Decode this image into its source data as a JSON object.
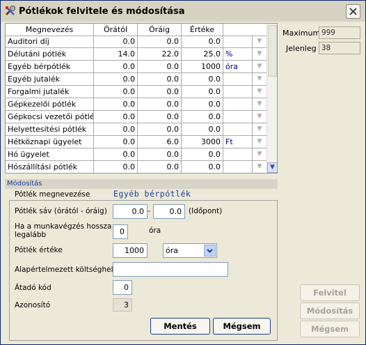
{
  "window": {
    "title": "Pótlékok felvitele és módosítása"
  },
  "grid": {
    "columns": [
      "Megnevezés",
      "Órától",
      "Óráig",
      "Értéke",
      ""
    ],
    "rows": [
      {
        "name": "Auditori díj",
        "from": "0.0",
        "to": "0.0",
        "value": "0.0",
        "unit": ""
      },
      {
        "name": "Délutáni pótlék",
        "from": "14.0",
        "to": "22.0",
        "value": "25.0",
        "unit": "%"
      },
      {
        "name": "Egyéb bérpótlék",
        "from": "0.0",
        "to": "0.0",
        "value": "1000",
        "unit": "óra"
      },
      {
        "name": "Egyéb jutalék",
        "from": "0.0",
        "to": "0.0",
        "value": "0.0",
        "unit": ""
      },
      {
        "name": "Forgalmi jutalék",
        "from": "0.0",
        "to": "0.0",
        "value": "0.0",
        "unit": ""
      },
      {
        "name": "Gépkezelői pótlék",
        "from": "0.0",
        "to": "0.0",
        "value": "0.0",
        "unit": ""
      },
      {
        "name": "Gépkocsi vezetői pótlé",
        "from": "0.0",
        "to": "0.0",
        "value": "0.0",
        "unit": ""
      },
      {
        "name": "Helyettesítési pótlék",
        "from": "0.0",
        "to": "0.0",
        "value": "0.0",
        "unit": ""
      },
      {
        "name": "Hétköznapi ügyelet",
        "from": "0.0",
        "to": "6.0",
        "value": "3000",
        "unit": "Ft"
      },
      {
        "name": "Hó ügyelet",
        "from": "0.0",
        "to": "0.0",
        "value": "0.0",
        "unit": ""
      },
      {
        "name": "Hószállítási pótlék",
        "from": "0.0",
        "to": "0.0",
        "value": "0.0",
        "unit": ""
      }
    ]
  },
  "stats": {
    "maximum_label": "Maximum",
    "maximum_value": "999",
    "current_label": "Jelenleg",
    "current_value": "38"
  },
  "form": {
    "section_title": "Módosítás",
    "name_label": "Pótlék megnevezése",
    "name_value": "Egyéb bérpótlék",
    "range_label": "Pótlék sáv (órától - óráig)",
    "range_from": "0.0",
    "range_sep": "-",
    "range_to": "0.0",
    "range_unit": "(Időpont)",
    "min_hours_label": "Ha a munkavégzés hossza legalább",
    "min_hours_value": "0",
    "min_hours_unit": "óra",
    "value_label": "Pótlék értéke",
    "value_value": "1000",
    "value_unit_selected": "óra",
    "cost_center_label": "Alapértelmezett költséghely",
    "cost_center_value": "",
    "transfer_code_label": "Átadó kód",
    "transfer_code_value": "0",
    "id_label": "Azonosító",
    "id_value": "3",
    "save_label": "Mentés",
    "cancel_label": "Mégsem"
  },
  "side_buttons": {
    "add_label": "Felvitel",
    "modify_label": "Módosítás",
    "cancel_label": "Mégsem"
  }
}
